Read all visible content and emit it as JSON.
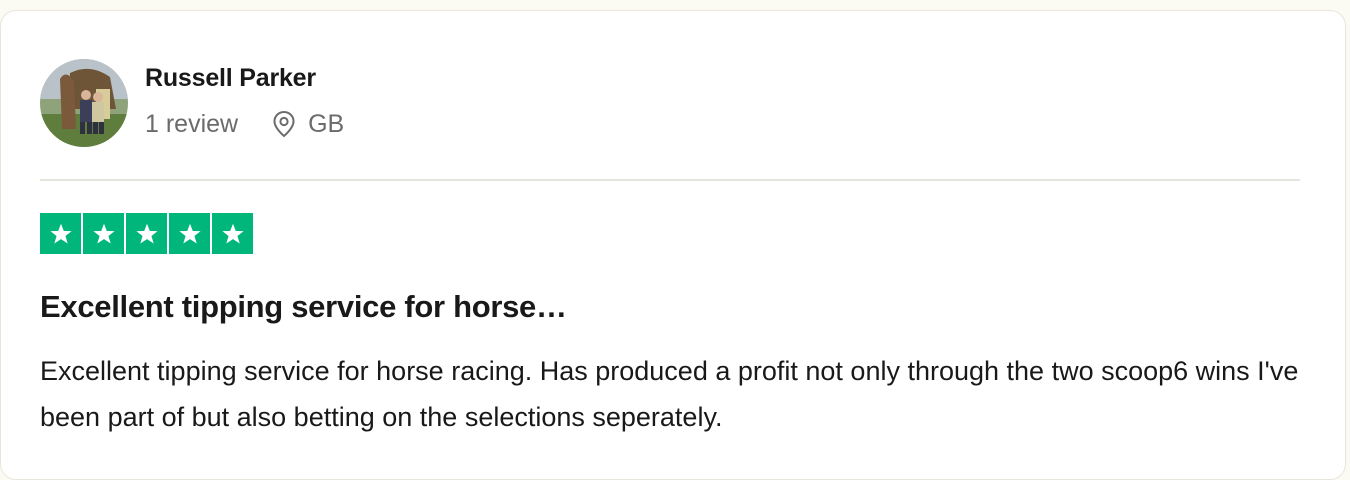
{
  "reviewer": {
    "name": "Russell Parker",
    "review_count": "1 review",
    "country": "GB",
    "avatar_icon": "reviewer-photo",
    "location_icon": "location-pin-icon"
  },
  "review": {
    "rating": 5,
    "max_rating": 5,
    "star_color": "#00b67a",
    "title": "Excellent tipping service for horse…",
    "body": "Excellent tipping service for horse racing. Has produced a profit not only through the two scoop6 wins I've been part of but also betting on the selections seperately."
  }
}
